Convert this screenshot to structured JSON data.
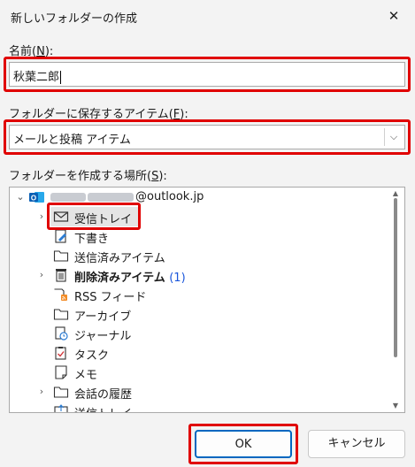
{
  "dialog": {
    "title": "新しいフォルダーの作成",
    "close_glyph": "✕"
  },
  "name_field": {
    "label_prefix": "名前(",
    "label_key": "N",
    "label_suffix": "):",
    "value": "秋葉二郎"
  },
  "contains_field": {
    "label_prefix": "フォルダーに保存するアイテム(",
    "label_key": "F",
    "label_suffix": "):",
    "value": "メールと投稿 アイテム"
  },
  "location_field": {
    "label_prefix": "フォルダーを作成する場所(",
    "label_key": "S",
    "label_suffix": "):"
  },
  "tree": {
    "account": {
      "email_suffix": "@outlook.jp",
      "icon": "outlook-account-icon"
    },
    "items": [
      {
        "label": "受信トレイ",
        "icon": "envelope-icon",
        "expander": "›",
        "selected": true
      },
      {
        "label": "下書き",
        "icon": "draft-icon",
        "expander": ""
      },
      {
        "label": "送信済みアイテム",
        "icon": "folder-icon",
        "expander": ""
      },
      {
        "label": "削除済みアイテム",
        "icon": "trash-icon",
        "expander": "›",
        "bold": true,
        "count": "(1)"
      },
      {
        "label": "RSS フィード",
        "icon": "rss-icon",
        "expander": ""
      },
      {
        "label": "アーカイブ",
        "icon": "folder-icon",
        "expander": ""
      },
      {
        "label": "ジャーナル",
        "icon": "journal-icon",
        "expander": ""
      },
      {
        "label": "タスク",
        "icon": "task-icon",
        "expander": ""
      },
      {
        "label": "メモ",
        "icon": "note-icon",
        "expander": ""
      },
      {
        "label": "会話の履歴",
        "icon": "folder-icon",
        "expander": "›"
      },
      {
        "label": "送信トレイ",
        "icon": "outbox-icon",
        "expander": ""
      }
    ]
  },
  "buttons": {
    "ok": "OK",
    "cancel": "キャンセル"
  },
  "colors": {
    "highlight_red": "#e00000",
    "primary_border": "#0067c0",
    "count_blue": "#1a56db"
  }
}
